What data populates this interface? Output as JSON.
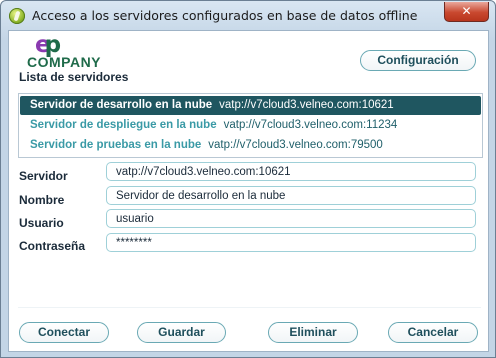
{
  "window": {
    "title": "Acceso a los servidores configurados en base de datos offline",
    "close_glyph": "✕"
  },
  "logo": {
    "mark_left": "e",
    "mark_right": "p",
    "word": "COMPANY"
  },
  "toolbar": {
    "config_label": "Configuración"
  },
  "server_list": {
    "label": "Lista de servidores",
    "selected_index": 0,
    "items": [
      {
        "name": "Servidor de desarrollo en la nube",
        "address": "vatp://v7cloud3.velneo.com:10621"
      },
      {
        "name": "Servidor de despliegue en la nube",
        "address": "vatp://v7cloud3.velneo.com:11234"
      },
      {
        "name": "Servidor de pruebas en la nube",
        "address": "vatp://v7cloud3.velneo.com:79500"
      }
    ]
  },
  "form": {
    "servidor": {
      "label": "Servidor",
      "value": "vatp://v7cloud3.velneo.com:10621"
    },
    "nombre": {
      "label": "Nombre",
      "value": "Servidor de desarrollo en la nube"
    },
    "usuario": {
      "label": "Usuario",
      "value": "usuario"
    },
    "contrasena": {
      "label": "Contraseña",
      "value": "********"
    }
  },
  "actions": {
    "conectar": "Conectar",
    "guardar": "Guardar",
    "eliminar": "Eliminar",
    "cancelar": "Cancelar"
  },
  "colors": {
    "selection": "#1f5660",
    "server_name": "#3a9aa6",
    "brand_purple": "#8a3ab0",
    "brand_green": "#1f6b4a",
    "button_border": "#6aa9b4",
    "field_border": "#9fd0d8"
  },
  "icons": {
    "app": "app-icon",
    "close": "close-icon"
  }
}
